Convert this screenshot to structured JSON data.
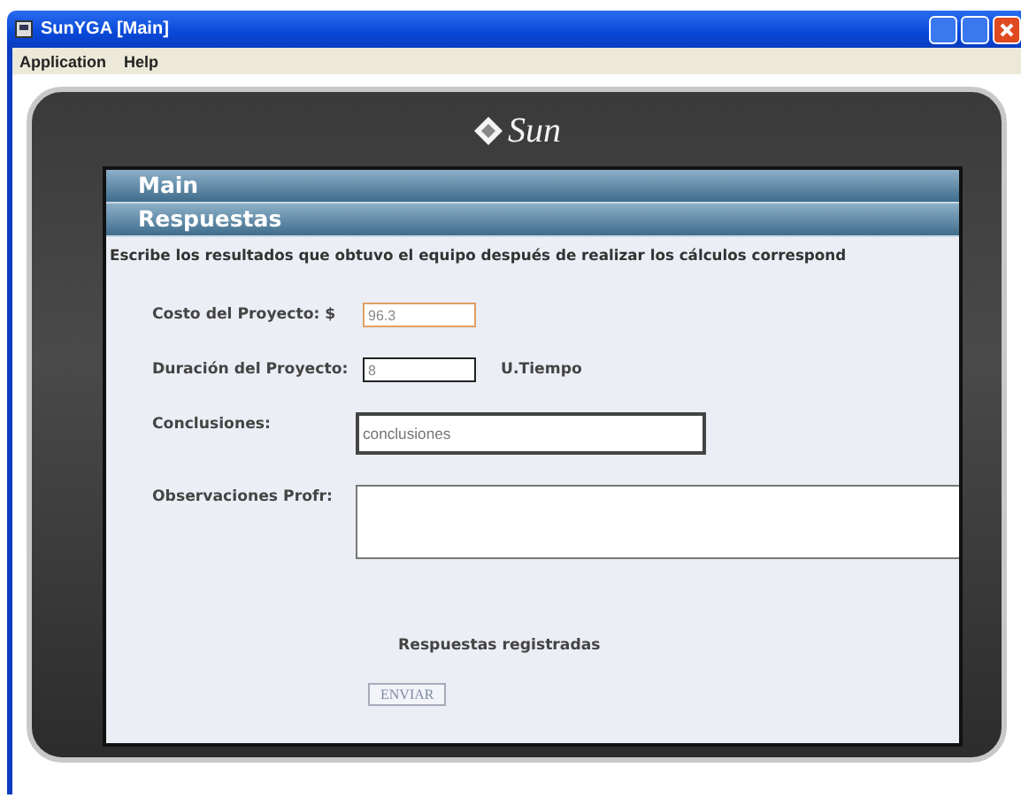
{
  "window": {
    "title": "SunYGA [Main]"
  },
  "menu": [
    "Application",
    "Help"
  ],
  "logo": {
    "text": "Sun"
  },
  "headers": [
    "Main",
    "Respuestas"
  ],
  "instruction": "Escribe los resultados que obtuvo el equipo después de realizar los cálculos correspond",
  "fields": [
    {
      "kind": "line",
      "label": "Costo del Proyecto: $",
      "value": "96.3",
      "focused": true
    },
    {
      "kind": "line",
      "label": "Duración del Proyecto:",
      "value": "8",
      "focused": false,
      "unit": "U.Tiempo"
    },
    {
      "kind": "box",
      "label": "Conclusiones:",
      "placeholder": "conclusiones",
      "focused": false
    },
    {
      "kind": "area",
      "label": "Observaciones Profr:",
      "focused": false
    }
  ],
  "status": "Respuestas registradas",
  "button": {
    "label": "ENVIAR",
    "disabled": true
  }
}
